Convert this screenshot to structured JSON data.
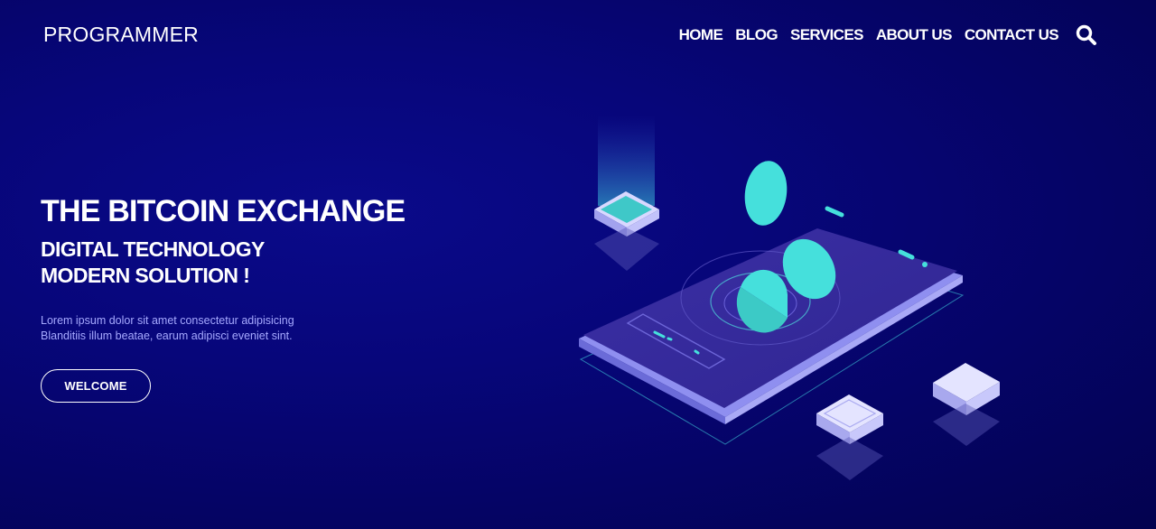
{
  "header": {
    "logo": "PROGRAMMER",
    "nav": [
      "HOME",
      "BLOG",
      "SERVICES",
      "ABOUT US",
      "CONTACT US"
    ],
    "search_icon": "search-icon"
  },
  "hero": {
    "title": "THE BITCOIN EXCHANGE",
    "subtitle_line1": "DIGITAL TECHNOLOGY",
    "subtitle_line2": "MODERN SOLUTION !",
    "text_line1": "Lorem ipsum dolor sit amet consectetur adipisicing",
    "text_line2": "Blanditiis illum beatae, earum adipisci eveniet sint.",
    "button_label": "WELCOME"
  },
  "colors": {
    "background": "#06056f",
    "accent_teal": "#45e0dc",
    "paragraph": "#a6a9ff",
    "phone": "#3a2fa0"
  }
}
